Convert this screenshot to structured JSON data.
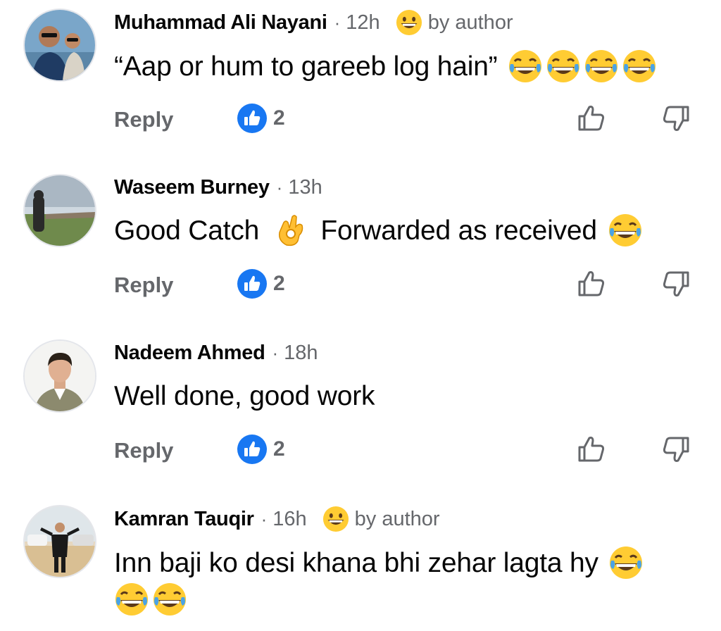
{
  "comments": [
    {
      "author": "Muhammad Ali Nayani",
      "separator": "·",
      "time": "12h",
      "badge": "by author",
      "badge_icon": "grinning-face-icon",
      "text": "“Aap or hum to gareeb log hain”",
      "emojis_after": [
        "joy-icon",
        "joy-icon",
        "joy-icon",
        "joy-icon"
      ],
      "reply_label": "Reply",
      "like_count": "2"
    },
    {
      "author": "Waseem Burney",
      "separator": "·",
      "time": "13h",
      "text_part1": "Good Catch",
      "mid_emoji": "ok-hand-icon",
      "text_part2": "Forwarded as received",
      "emojis_after": [
        "joy-icon"
      ],
      "reply_label": "Reply",
      "like_count": "2"
    },
    {
      "author": "Nadeem Ahmed",
      "separator": "·",
      "time": "18h",
      "text": "Well done, good work",
      "reply_label": "Reply",
      "like_count": "2"
    },
    {
      "author": "Kamran Tauqir",
      "separator": "·",
      "time": "16h",
      "badge": "by author",
      "badge_icon": "grinning-face-icon",
      "text": "Inn baji ko desi khana bhi zehar lagta hy",
      "emojis_after": [
        "joy-icon"
      ],
      "emojis_line2": [
        "joy-icon",
        "joy-icon"
      ]
    }
  ],
  "colors": {
    "secondary_text": "#65676b",
    "like_blue": "#1877f2",
    "emoji_yellow": "#ffcc33"
  }
}
